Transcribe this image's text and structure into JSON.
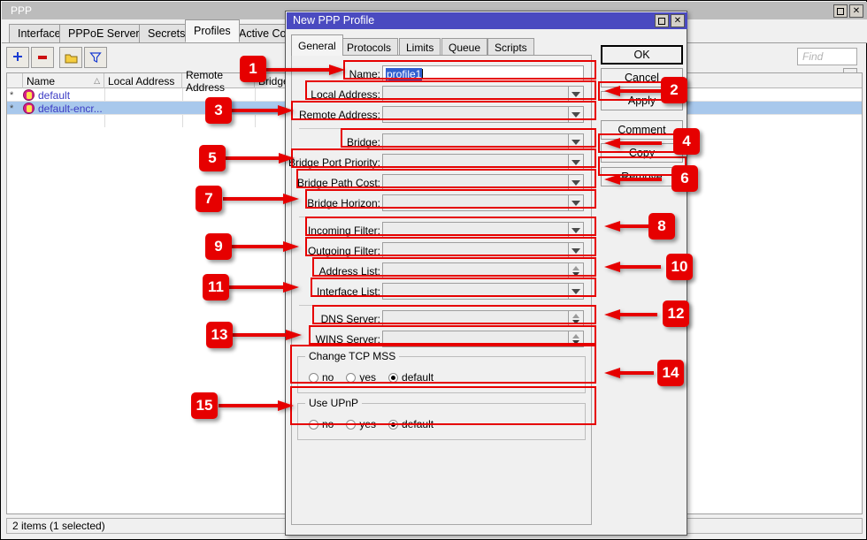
{
  "main_window": {
    "title": "PPP",
    "window_controls": [
      {
        "name": "restore",
        "glyph": "□"
      },
      {
        "name": "close",
        "glyph": "✕"
      }
    ],
    "tabs": [
      {
        "label": "Interface",
        "active": false
      },
      {
        "label": "PPPoE Servers",
        "active": false
      },
      {
        "label": "Secrets",
        "active": false
      },
      {
        "label": "Profiles",
        "active": true
      },
      {
        "label": "Active Connec",
        "active": false
      }
    ],
    "toolbar": [
      {
        "name": "add-button",
        "glyph": "+"
      },
      {
        "name": "remove-button",
        "glyph": "−"
      },
      {
        "name": "enable-button",
        "glyph": "folder"
      },
      {
        "name": "filter-button",
        "glyph": "filter"
      }
    ],
    "search": {
      "placeholder": "Find",
      "value": ""
    },
    "list": {
      "columns": [
        "Name",
        "Local Address",
        "Remote Address",
        "Bridge"
      ],
      "sort_indicator": "△",
      "rows": [
        {
          "flag": "*",
          "name": "default",
          "local_address": "",
          "remote_address": "",
          "bridge": "",
          "selected": false
        },
        {
          "flag": "*",
          "name": "default-encr...",
          "local_address": "",
          "remote_address": "",
          "bridge": "",
          "selected": true
        }
      ]
    },
    "status": "2 items (1 selected)"
  },
  "dialog": {
    "title": "New PPP Profile",
    "window_controls": [
      {
        "name": "restore",
        "glyph": "□"
      },
      {
        "name": "close",
        "glyph": "✕"
      }
    ],
    "tabs": [
      {
        "label": "General",
        "active": true
      },
      {
        "label": "Protocols",
        "active": false
      },
      {
        "label": "Limits",
        "active": false
      },
      {
        "label": "Queue",
        "active": false
      },
      {
        "label": "Scripts",
        "active": false
      }
    ],
    "fields": [
      {
        "label": "Name:",
        "value": "profile1",
        "control": "text",
        "selected": true
      },
      {
        "label": "Local Address:",
        "value": "",
        "control": "dropdown"
      },
      {
        "label": "Remote Address:",
        "value": "",
        "control": "dropdown"
      },
      {
        "label": "Bridge:",
        "value": "",
        "control": "dropdown"
      },
      {
        "label": "Bridge Port Priority:",
        "value": "",
        "control": "dropdown"
      },
      {
        "label": "Bridge Path Cost:",
        "value": "",
        "control": "dropdown"
      },
      {
        "label": "Bridge Horizon:",
        "value": "",
        "control": "dropdown"
      },
      {
        "label": "Incoming Filter:",
        "value": "",
        "control": "dropdown"
      },
      {
        "label": "Outgoing Filter:",
        "value": "",
        "control": "dropdown"
      },
      {
        "label": "Address List:",
        "value": "",
        "control": "spinner"
      },
      {
        "label": "Interface List:",
        "value": "",
        "control": "dropdown"
      },
      {
        "label": "DNS Server:",
        "value": "",
        "control": "spinner"
      },
      {
        "label": "WINS Server:",
        "value": "",
        "control": "spinner"
      }
    ],
    "groups": [
      {
        "legend": "Change TCP MSS",
        "options": [
          {
            "label": "no",
            "selected": false
          },
          {
            "label": "yes",
            "selected": false
          },
          {
            "label": "default",
            "selected": true
          }
        ]
      },
      {
        "legend": "Use UPnP",
        "options": [
          {
            "label": "no",
            "selected": false
          },
          {
            "label": "yes",
            "selected": false
          },
          {
            "label": "default",
            "selected": true
          }
        ]
      }
    ],
    "buttons": [
      {
        "label": "OK",
        "primary": true
      },
      {
        "label": "Cancel",
        "primary": false
      },
      {
        "label": "Apply",
        "primary": false
      },
      {
        "label": "Comment",
        "primary": false
      },
      {
        "label": "Copy",
        "primary": false
      },
      {
        "label": "Remove",
        "primary": false
      }
    ]
  },
  "annotations": {
    "accent_color": "#e60000",
    "badges": [
      {
        "number": "1",
        "target": "name-field"
      },
      {
        "number": "2",
        "target": "apply-button"
      },
      {
        "number": "3",
        "target": "remote-address-field"
      },
      {
        "number": "4",
        "target": "copy-button"
      },
      {
        "number": "5",
        "target": "bridge-port-priority-field"
      },
      {
        "number": "6",
        "target": "remove-button"
      },
      {
        "number": "7",
        "target": "bridge-horizon-field"
      },
      {
        "number": "8",
        "target": "incoming-filter-field"
      },
      {
        "number": "9",
        "target": "outgoing-filter-field"
      },
      {
        "number": "10",
        "target": "address-list-field"
      },
      {
        "number": "11",
        "target": "interface-list-field"
      },
      {
        "number": "12",
        "target": "dns-server-field"
      },
      {
        "number": "13",
        "target": "wins-server-field"
      },
      {
        "number": "14",
        "target": "change-tcp-mss-group"
      },
      {
        "number": "15",
        "target": "use-upnp-group"
      }
    ]
  }
}
